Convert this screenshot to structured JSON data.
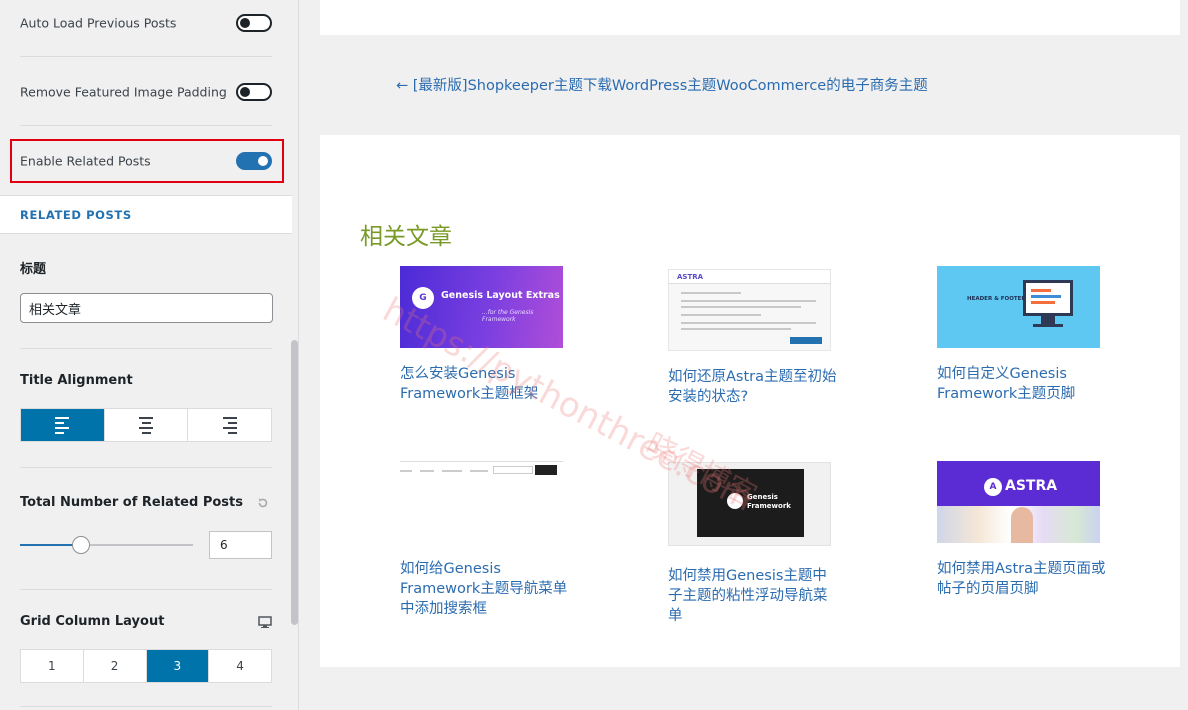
{
  "sidebar": {
    "toggles": [
      {
        "label": "Auto Load Previous Posts",
        "on": false
      },
      {
        "label": "Remove Featured Image Padding",
        "on": false
      },
      {
        "label": "Enable Related Posts",
        "on": true
      }
    ],
    "section_heading": "RELATED POSTS",
    "title_field": {
      "label": "标题",
      "value": "相关文章"
    },
    "title_alignment": {
      "label": "Title Alignment",
      "options": [
        "align-left",
        "align-center",
        "align-right"
      ],
      "selected": 0
    },
    "total_related": {
      "label": "Total Number of Related Posts",
      "value": "6",
      "slider_fraction": 0.35
    },
    "grid_layout": {
      "label": "Grid Column Layout",
      "options": [
        "1",
        "2",
        "3",
        "4"
      ],
      "selected": 2
    }
  },
  "preview": {
    "prev_post_link": "← [最新版]Shopkeeper主题下载WordPress主题WooCommerce的电子商务主题",
    "related_heading": "相关文章",
    "posts": [
      {
        "title": "怎么安装Genesis Framework主题框架",
        "thumb_text": "Genesis Layout Extras",
        "thumb_subtext": "...for the Genesis Framework",
        "thumb_logo": "G"
      },
      {
        "title": "如何还原Astra主题至初始安装的状态?",
        "thumb_text": "ASTRA"
      },
      {
        "title": "如何自定义Genesis Framework主题页脚",
        "thumb_text": "HEADER & FOOTER"
      },
      {
        "title": "如何给Genesis Framework主题导航菜单中添加搜索框"
      },
      {
        "title": "如何禁用Genesis主题中子主题的粘性浮动导航菜单",
        "thumb_text": "Genesis Framework"
      },
      {
        "title": "如何禁用Astra主题页面或帖子的页眉页脚",
        "thumb_text": "ASTRA",
        "thumb_logo": "A"
      }
    ]
  },
  "watermark": {
    "url": "https://pythonthree.com",
    "name": "晓得博客"
  },
  "colors": {
    "accent": "#2271b1",
    "highlight": "#e0000f",
    "related_heading": "#7a9a28",
    "link": "#2b6cb0"
  }
}
